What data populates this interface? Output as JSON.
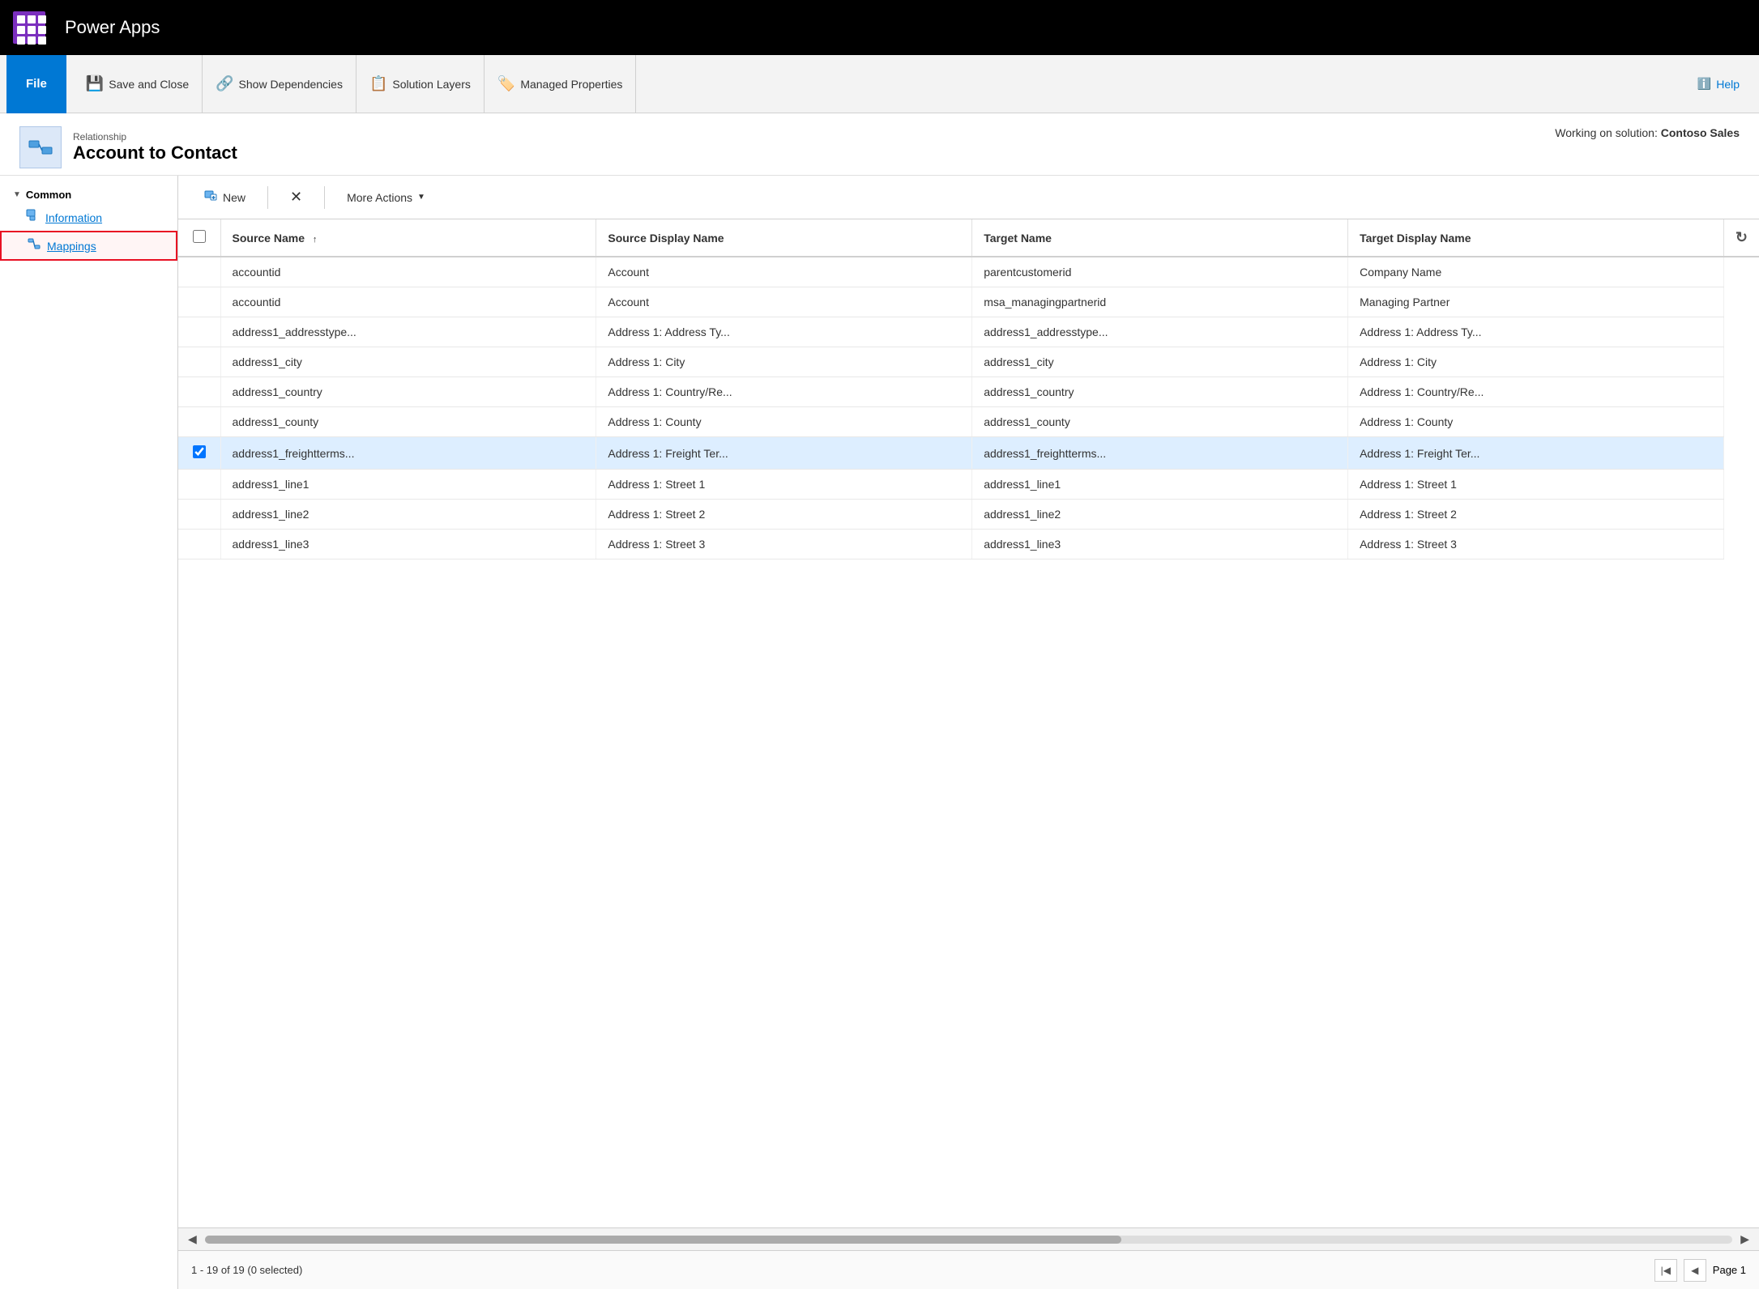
{
  "app": {
    "title": "Power Apps"
  },
  "ribbon": {
    "file_label": "File",
    "save_close_label": "Save and Close",
    "show_dependencies_label": "Show Dependencies",
    "solution_layers_label": "Solution Layers",
    "managed_properties_label": "Managed Properties",
    "help_label": "Help"
  },
  "page": {
    "subtitle": "Relationship",
    "title": "Account to Contact",
    "working_on_prefix": "Working on solution:",
    "working_on_name": "Contoso Sales"
  },
  "sidebar": {
    "section_label": "Common",
    "items": [
      {
        "label": "Information",
        "selected": false
      },
      {
        "label": "Mappings",
        "selected": true
      }
    ]
  },
  "toolbar": {
    "new_label": "New",
    "delete_label": "×",
    "more_actions_label": "More Actions"
  },
  "table": {
    "columns": [
      {
        "label": "Source Name",
        "sortable": true
      },
      {
        "label": "Source Display Name",
        "sortable": false
      },
      {
        "label": "Target Name",
        "sortable": false
      },
      {
        "label": "Target Display Name",
        "sortable": false
      }
    ],
    "rows": [
      {
        "source_name": "accountid",
        "source_display": "Account",
        "target_name": "parentcustomerid",
        "target_display": "Company Name",
        "selected": false
      },
      {
        "source_name": "accountid",
        "source_display": "Account",
        "target_name": "msa_managingpartnerid",
        "target_display": "Managing Partner",
        "selected": false
      },
      {
        "source_name": "address1_addresstype...",
        "source_display": "Address 1: Address Ty...",
        "target_name": "address1_addresstype...",
        "target_display": "Address 1: Address Ty...",
        "selected": false
      },
      {
        "source_name": "address1_city",
        "source_display": "Address 1: City",
        "target_name": "address1_city",
        "target_display": "Address 1: City",
        "selected": false
      },
      {
        "source_name": "address1_country",
        "source_display": "Address 1: Country/Re...",
        "target_name": "address1_country",
        "target_display": "Address 1: Country/Re...",
        "selected": false
      },
      {
        "source_name": "address1_county",
        "source_display": "Address 1: County",
        "target_name": "address1_county",
        "target_display": "Address 1: County",
        "selected": false
      },
      {
        "source_name": "address1_freightterms...",
        "source_display": "Address 1: Freight Ter...",
        "target_name": "address1_freightterms...",
        "target_display": "Address 1: Freight Ter...",
        "selected": true
      },
      {
        "source_name": "address1_line1",
        "source_display": "Address 1: Street 1",
        "target_name": "address1_line1",
        "target_display": "Address 1: Street 1",
        "selected": false
      },
      {
        "source_name": "address1_line2",
        "source_display": "Address 1: Street 2",
        "target_name": "address1_line2",
        "target_display": "Address 1: Street 2",
        "selected": false
      },
      {
        "source_name": "address1_line3",
        "source_display": "Address 1: Street 3",
        "target_name": "address1_line3",
        "target_display": "Address 1: Street 3",
        "selected": false
      }
    ],
    "footer_status": "1 - 19 of 19 (0 selected)",
    "page_label": "Page 1"
  }
}
